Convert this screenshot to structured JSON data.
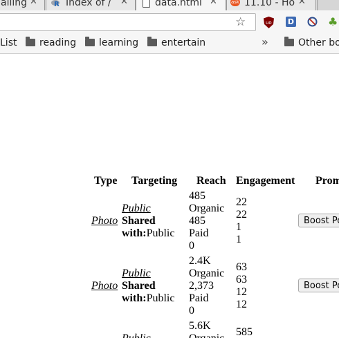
{
  "tabs": [
    {
      "title": "ailing",
      "active": false
    },
    {
      "title": "Index of /",
      "active": false
    },
    {
      "title": "data.html",
      "active": true
    },
    {
      "title": "11.10 - Ho",
      "active": false
    }
  ],
  "bookmarks": {
    "items": [
      "List",
      "reading",
      "learning",
      "entertain"
    ],
    "overflow": "»",
    "other": "Other bo"
  },
  "table": {
    "headers": [
      "Type",
      "Targeting",
      "Reach",
      "Engagement",
      "Prom"
    ],
    "rows": [
      {
        "type": "Photo",
        "targeting_link": "Public",
        "shared_label": "Shared",
        "with_label": "with:",
        "with_value": "Public",
        "reach": [
          "485",
          "Organic",
          "485",
          "Paid",
          "0"
        ],
        "engagement": [
          "22",
          "22",
          "1",
          "1"
        ],
        "promote": "Boost Po"
      },
      {
        "type": "Photo",
        "targeting_link": "Public",
        "shared_label": "Shared",
        "with_label": "with:",
        "with_value": "Public",
        "reach": [
          "2.4K",
          "Organic",
          "2,373",
          "Paid",
          "0"
        ],
        "engagement": [
          "63",
          "63",
          "12",
          "12"
        ],
        "promote": "Boost Po"
      },
      {
        "targeting_link": "Public",
        "reach": [
          "5.6K",
          "Organic"
        ],
        "engagement": [
          "585"
        ]
      }
    ]
  }
}
